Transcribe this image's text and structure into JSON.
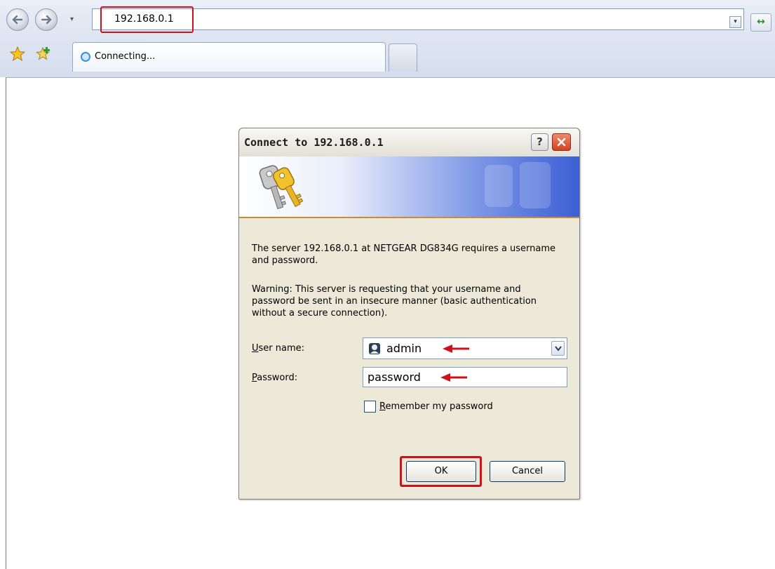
{
  "browser": {
    "address_url": "192.168.0.1",
    "tab_label": "Connecting...",
    "nav_dropdown_glyph": "▾",
    "address_dropdown_glyph": "▾",
    "refresh_glyph": "↔",
    "icons": [
      "back-icon",
      "forward-icon",
      "favorites-star-icon",
      "add-favorites-icon",
      "loading-spinner-icon",
      "refresh-icon"
    ]
  },
  "dialog": {
    "title": "Connect to 192.168.0.1",
    "help_glyph": "?",
    "message": "The server 192.168.0.1 at NETGEAR DG834G  requires a username and password.",
    "warning": "Warning: This server is requesting that your username and password be sent in an insecure manner (basic authentication without a secure connection).",
    "username_label_first": "U",
    "username_label_rest": "ser name:",
    "username_value": "admin",
    "password_label_first": "P",
    "password_label_rest": "assword:",
    "password_value": "password",
    "remember_label_first": "R",
    "remember_label_rest": "emember my password",
    "remember_checked": false,
    "ok_label": "OK",
    "cancel_label": "Cancel"
  },
  "colors": {
    "highlight_red": "#d0101a",
    "banner_blue": "#3b5fd5",
    "dialog_bg": "#ece9d8"
  }
}
